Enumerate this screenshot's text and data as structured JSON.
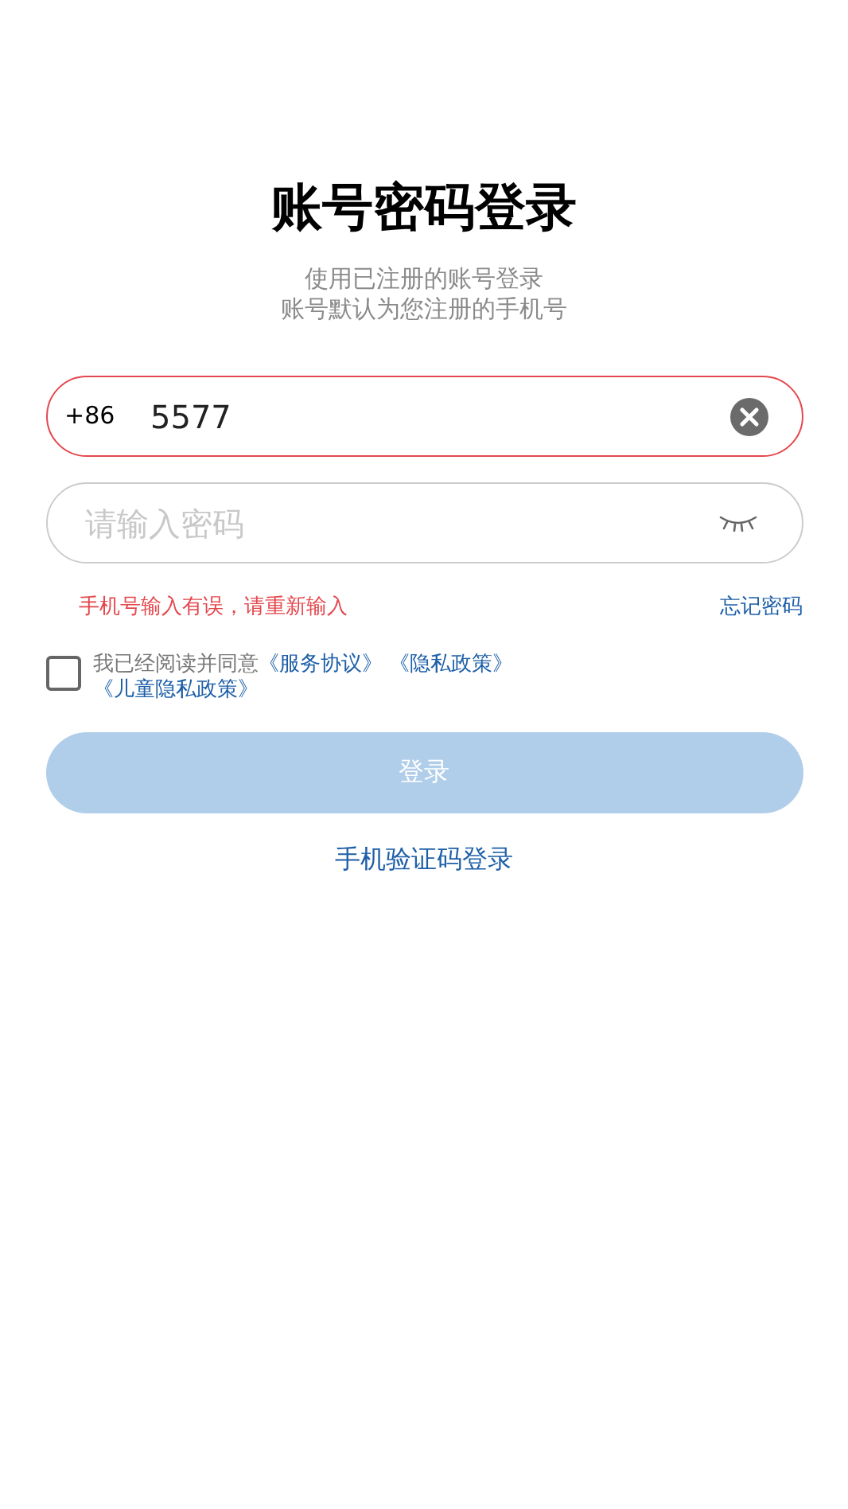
{
  "title": "账号密码登录",
  "subtitle": [
    "使用已注册的账号登录",
    "账号默认为您注册的手机号"
  ],
  "phone": {
    "country_code": "+86",
    "value": "5577",
    "error": true
  },
  "password": {
    "placeholder": "请输入密码"
  },
  "error_message": "手机号输入有误，请重新输入",
  "forgot_link": "忘记密码",
  "agreement": {
    "checked": false,
    "text": "我已经阅读并同意",
    "links": [
      "《服务协议》",
      "《隐私政策》",
      "《儿童隐私政策》"
    ]
  },
  "login_button": {
    "label": "登录",
    "disabled": true
  },
  "sms_login_link": "手机验证码登录"
}
